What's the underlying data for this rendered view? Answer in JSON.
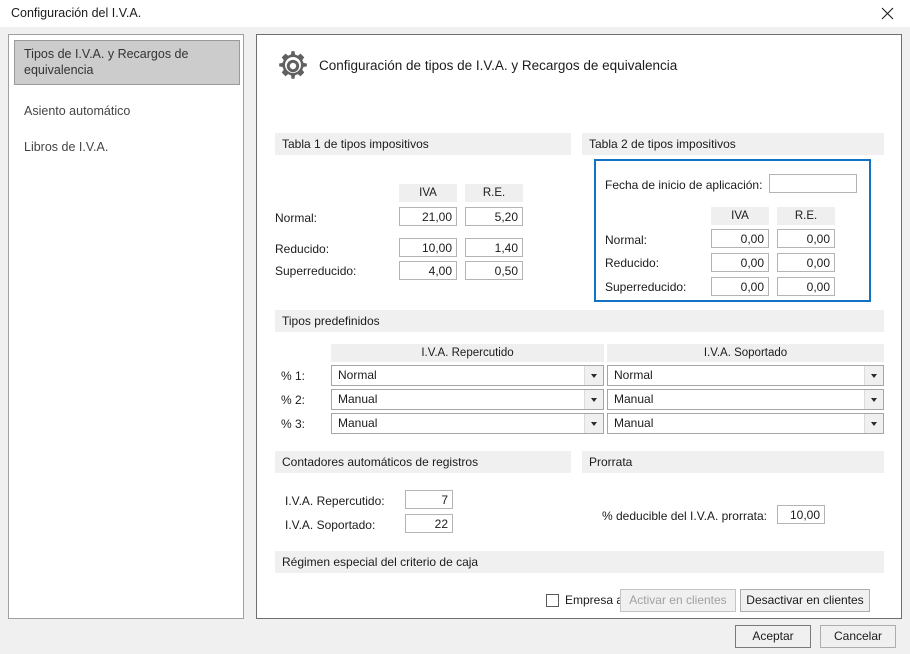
{
  "window": {
    "title": "Configuración del I.V.A.",
    "close_icon": "close-icon"
  },
  "sidebar": {
    "items": [
      {
        "label": "Tipos de I.V.A. y Recargos de equivalencia",
        "selected": true
      },
      {
        "label": "Asiento automático",
        "selected": false
      },
      {
        "label": "Libros de I.V.A.",
        "selected": false
      }
    ]
  },
  "content": {
    "icon": "gear-icon",
    "title": "Configuración de tipos de I.V.A. y Recargos de equivalencia"
  },
  "table1": {
    "section_title": "Tabla 1 de tipos impositivos",
    "col_iva": "IVA",
    "col_re": "R.E.",
    "rows": [
      {
        "label": "Normal:",
        "iva": "21,00",
        "re": "5,20"
      },
      {
        "label": "Reducido:",
        "iva": "10,00",
        "re": "1,40"
      },
      {
        "label": "Superreducido:",
        "iva": "4,00",
        "re": "0,50"
      }
    ]
  },
  "table2": {
    "section_title": "Tabla 2 de tipos impositivos",
    "highlight_color": "#1272c4",
    "date_label": "Fecha de inicio de aplicación:",
    "date_value": "",
    "col_iva": "IVA",
    "col_re": "R.E.",
    "rows": [
      {
        "label": "Normal:",
        "iva": "0,00",
        "re": "0,00"
      },
      {
        "label": "Reducido:",
        "iva": "0,00",
        "re": "0,00"
      },
      {
        "label": "Superreducido:",
        "iva": "0,00",
        "re": "0,00"
      }
    ]
  },
  "predefined": {
    "section_title": "Tipos predefinidos",
    "col_repercutido": "I.V.A. Repercutido",
    "col_soportado": "I.V.A. Soportado",
    "rows": [
      {
        "label": "% 1:",
        "repercutido": "Normal",
        "soportado": "Normal"
      },
      {
        "label": "% 2:",
        "repercutido": "Manual",
        "soportado": "Manual"
      },
      {
        "label": "% 3:",
        "repercutido": "Manual",
        "soportado": "Manual"
      }
    ]
  },
  "counters": {
    "section_title": "Contadores automáticos de registros",
    "rows": [
      {
        "label": "I.V.A. Repercutido:",
        "value": "7"
      },
      {
        "label": "I.V.A. Soportado:",
        "value": "22"
      }
    ]
  },
  "prorrata": {
    "section_title": "Prorrata",
    "label": "% deducible del I.V.A. prorrata:",
    "value": "10,00"
  },
  "recc": {
    "section_title": "Régimen especial del criterio de caja",
    "checkbox_label": "Empresa acogida al RECC",
    "checked": false,
    "activate_button": "Activar en clientes",
    "activate_enabled": false,
    "deactivate_button": "Desactivar en clientes",
    "deactivate_enabled": true
  },
  "footer": {
    "accept_button": "Aceptar",
    "cancel_button": "Cancelar"
  }
}
